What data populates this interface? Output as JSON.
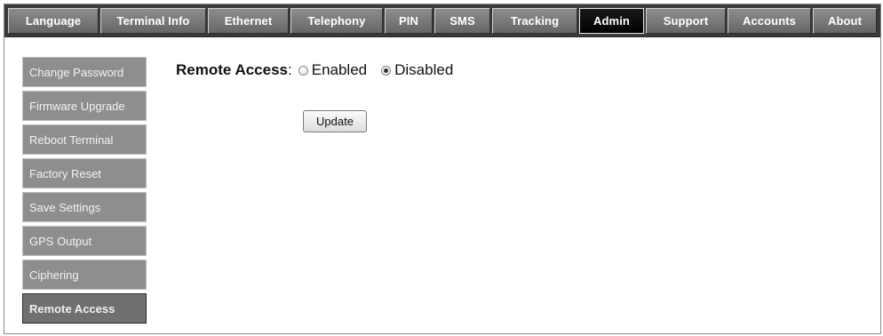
{
  "tabs": [
    {
      "label": "Language"
    },
    {
      "label": "Terminal Info"
    },
    {
      "label": "Ethernet"
    },
    {
      "label": "Telephony"
    },
    {
      "label": "PIN"
    },
    {
      "label": "SMS"
    },
    {
      "label": "Tracking"
    },
    {
      "label": "Admin",
      "active": true
    },
    {
      "label": "Support"
    },
    {
      "label": "Accounts"
    },
    {
      "label": "About"
    }
  ],
  "sidebar": {
    "items": [
      {
        "label": "Change Password"
      },
      {
        "label": "Firmware Upgrade"
      },
      {
        "label": "Reboot Terminal"
      },
      {
        "label": "Factory Reset"
      },
      {
        "label": "Save Settings"
      },
      {
        "label": "GPS Output"
      },
      {
        "label": "Ciphering"
      },
      {
        "label": "Remote Access",
        "active": true
      }
    ]
  },
  "main": {
    "remote_access": {
      "title": "Remote Access",
      "separator": ":",
      "options": [
        {
          "label": "Enabled",
          "checked": false
        },
        {
          "label": "Disabled",
          "checked": true
        }
      ]
    },
    "update_label": "Update"
  }
}
